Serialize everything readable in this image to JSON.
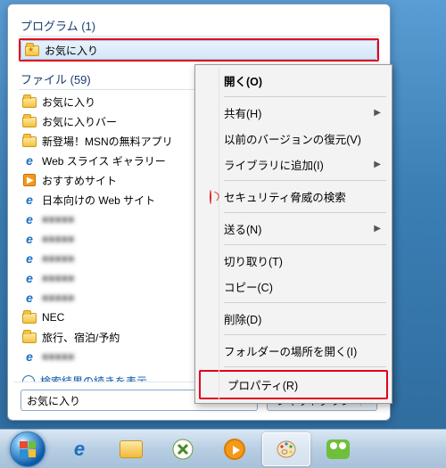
{
  "sections": {
    "programs": {
      "header": "プログラム (1)",
      "item_label": "お気に入り"
    },
    "files": {
      "header": "ファイル (59)",
      "items": [
        {
          "label": "お気に入り",
          "icon": "folder"
        },
        {
          "label": "お気に入りバー",
          "icon": "folder"
        },
        {
          "label": "新登場！MSNの無料アプリ",
          "icon": "folder"
        },
        {
          "label": "Web スライス ギャラリー",
          "icon": "ie"
        },
        {
          "label": "おすすめサイト",
          "icon": "ie-sugg"
        },
        {
          "label": "日本向けの Web サイト",
          "icon": "ie"
        },
        {
          "label": "blur1",
          "icon": "ie",
          "blur": true
        },
        {
          "label": "blur2",
          "icon": "ie",
          "blur": true
        },
        {
          "label": "blur3",
          "icon": "ie",
          "blur": true
        },
        {
          "label": "blur4",
          "icon": "ie",
          "blur": true
        },
        {
          "label": "blur5",
          "icon": "ie",
          "blur": true
        },
        {
          "label": "NEC",
          "icon": "folder"
        },
        {
          "label": "旅行、宿泊/予約",
          "icon": "folder"
        },
        {
          "label": "blur6",
          "icon": "ie",
          "blur": true
        }
      ]
    }
  },
  "show_more": "検索結果の続きを表示",
  "search": {
    "value": "お気に入り",
    "clear": "×"
  },
  "shutdown": {
    "label": "シャットダウン",
    "arrow": "▸"
  },
  "context_menu": {
    "open": "開く(O)",
    "share": "共有(H)",
    "restore": "以前のバージョンの復元(V)",
    "library": "ライブラリに追加(I)",
    "security": "セキュリティ脅威の検索",
    "sendto": "送る(N)",
    "cut": "切り取り(T)",
    "copy": "コピー(C)",
    "delete": "削除(D)",
    "openloc": "フォルダーの場所を開く(I)",
    "properties": "プロパティ(R)"
  }
}
